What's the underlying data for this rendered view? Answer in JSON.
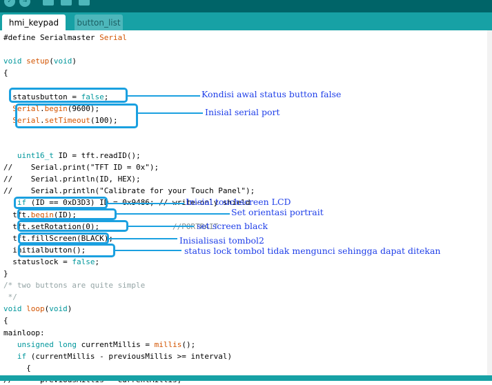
{
  "tabs": [
    {
      "label": "hmi_keypad",
      "active": true
    },
    {
      "label": "button_list",
      "active": false
    }
  ],
  "code": [
    [
      {
        "t": "#define Serialmaster ",
        "c": ""
      },
      {
        "t": "Serial",
        "c": "fn"
      }
    ],
    [],
    [
      {
        "t": "void",
        "c": "kw"
      },
      {
        "t": " ",
        "c": ""
      },
      {
        "t": "setup",
        "c": "fn"
      },
      {
        "t": "(",
        "c": ""
      },
      {
        "t": "void",
        "c": "kw"
      },
      {
        "t": ")",
        "c": ""
      }
    ],
    [
      {
        "t": "{",
        "c": ""
      }
    ],
    [],
    [
      {
        "t": "  statusbutton = ",
        "c": ""
      },
      {
        "t": "false",
        "c": "kw"
      },
      {
        "t": ";",
        "c": ""
      }
    ],
    [
      {
        "t": "  ",
        "c": ""
      },
      {
        "t": "Serial",
        "c": "fn"
      },
      {
        "t": ".",
        "c": ""
      },
      {
        "t": "begin",
        "c": "fn"
      },
      {
        "t": "(9600);",
        "c": ""
      }
    ],
    [
      {
        "t": "  ",
        "c": ""
      },
      {
        "t": "Serial",
        "c": "fn"
      },
      {
        "t": ".",
        "c": ""
      },
      {
        "t": "setTimeout",
        "c": "fn"
      },
      {
        "t": "(100);",
        "c": ""
      }
    ],
    [],
    [],
    [
      {
        "t": "   ",
        "c": ""
      },
      {
        "t": "uint16_t",
        "c": "ty"
      },
      {
        "t": " ID = tft.readID();",
        "c": ""
      }
    ],
    [
      {
        "t": "//    Serial.print(\"TFT ID = 0x\");",
        "c": ""
      }
    ],
    [
      {
        "t": "//    Serial.println(ID, HEX);",
        "c": ""
      }
    ],
    [
      {
        "t": "//    Serial.println(\"Calibrate for your Touch Panel\");",
        "c": ""
      }
    ],
    [
      {
        "t": "   ",
        "c": ""
      },
      {
        "t": "if",
        "c": "kw"
      },
      {
        "t": " (ID == 0xD3D3) ID = 0x9486; // write-only shield",
        "c": ""
      }
    ],
    [
      {
        "t": "  tft.",
        "c": ""
      },
      {
        "t": "begin",
        "c": "fn"
      },
      {
        "t": "(ID);",
        "c": ""
      }
    ],
    [
      {
        "t": "  tft.setRotation(0);",
        "c": ""
      }
    ],
    [
      {
        "t": "  tft.fillScreen(BLACK);",
        "c": ""
      }
    ],
    [
      {
        "t": "  initialbutton();",
        "c": ""
      }
    ],
    [
      {
        "t": "  statuslock = ",
        "c": ""
      },
      {
        "t": "false",
        "c": "kw"
      },
      {
        "t": ";",
        "c": ""
      }
    ],
    [
      {
        "t": "}",
        "c": ""
      }
    ],
    [
      {
        "t": "/* two buttons are quite simple",
        "c": "cm"
      }
    ],
    [
      {
        "t": " */",
        "c": "cm"
      }
    ],
    [
      {
        "t": "void",
        "c": "kw"
      },
      {
        "t": " ",
        "c": ""
      },
      {
        "t": "loop",
        "c": "fn"
      },
      {
        "t": "(",
        "c": ""
      },
      {
        "t": "void",
        "c": "kw"
      },
      {
        "t": ")",
        "c": ""
      }
    ],
    [
      {
        "t": "{",
        "c": ""
      }
    ],
    [
      {
        "t": "mainloop:",
        "c": ""
      }
    ],
    [
      {
        "t": "   ",
        "c": ""
      },
      {
        "t": "unsigned",
        "c": "kw"
      },
      {
        "t": " ",
        "c": ""
      },
      {
        "t": "long",
        "c": "kw"
      },
      {
        "t": " currentMillis = ",
        "c": ""
      },
      {
        "t": "millis",
        "c": "fn"
      },
      {
        "t": "();",
        "c": ""
      }
    ],
    [
      {
        "t": "   ",
        "c": ""
      },
      {
        "t": "if",
        "c": "kw"
      },
      {
        "t": " (currentMillis - previousMillis >= interval)",
        "c": ""
      }
    ],
    [
      {
        "t": "     {",
        "c": ""
      }
    ],
    [
      {
        "t": "//      previousMillis = currentMillis;",
        "c": ""
      }
    ]
  ],
  "behind_text": "//PORTRAIT",
  "annotations": [
    {
      "name": "annot-status-button",
      "text": "Kondisi awal status button false"
    },
    {
      "name": "annot-serial-port",
      "text": "Inisial serial port"
    },
    {
      "name": "annot-touchscreen",
      "text": "Inisial touchscreen LCD"
    },
    {
      "name": "annot-portrait",
      "text": "Set orientasi portrait"
    },
    {
      "name": "annot-screen-black",
      "text": "set screen black"
    },
    {
      "name": "annot-tombol2",
      "text": "Inisialisasi tombol2"
    },
    {
      "name": "annot-status-lock",
      "text": "status lock tombol tidak mengunci sehingga dapat ditekan"
    }
  ],
  "colors": {
    "toolbar": "#006468",
    "tabbar": "#17a1a5",
    "keyword": "#00979c",
    "function": "#d35400",
    "comment": "#95a5a6",
    "highlight_box": "#1aa0e0",
    "annotation_text": "#1e3ee8"
  }
}
